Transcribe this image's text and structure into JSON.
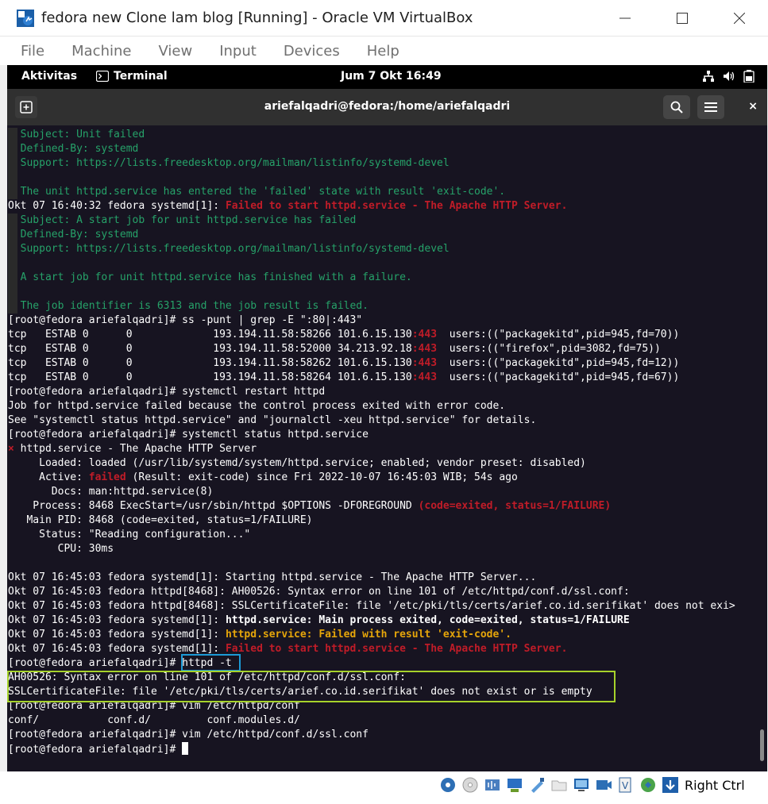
{
  "window": {
    "title": "fedora new Clone lam blog [Running] - Oracle VM VirtualBox",
    "controls": [
      "minimize-icon",
      "maximize-icon",
      "close-icon"
    ]
  },
  "menubar": {
    "items": [
      "File",
      "Machine",
      "View",
      "Input",
      "Devices",
      "Help"
    ]
  },
  "gnome": {
    "activities": "Aktivitas",
    "app_name": "Terminal",
    "clock": "Jum 7 Okt  16:49",
    "tray_icons": [
      "network-icon",
      "volume-icon",
      "battery-icon"
    ]
  },
  "terminal": {
    "title": "ariefalqadri@fedora:/home/ariefalqadri",
    "close_label": "×",
    "lines": [
      {
        "ind": true,
        "segs": [
          {
            "t": "  Subject: Unit failed",
            "c": "g"
          }
        ]
      },
      {
        "ind": true,
        "segs": [
          {
            "t": "  Defined-By: systemd",
            "c": "g"
          }
        ]
      },
      {
        "ind": true,
        "segs": [
          {
            "t": "  Support: https://lists.freedesktop.org/mailman/listinfo/systemd-devel",
            "c": "g"
          }
        ]
      },
      {
        "ind": true,
        "segs": [
          {
            "t": "",
            "c": ""
          }
        ]
      },
      {
        "ind": true,
        "segs": [
          {
            "t": "  The unit httpd.service has entered the 'failed' state with result 'exit-code'.",
            "c": "g"
          }
        ]
      },
      {
        "ind": false,
        "segs": [
          {
            "t": "Okt 07 16:40:32 fedora systemd[1]: ",
            "c": ""
          },
          {
            "t": "Failed to start httpd.service - The Apache HTTP Server.",
            "c": "r"
          }
        ]
      },
      {
        "ind": true,
        "segs": [
          {
            "t": "  Subject: A start job for unit httpd.service has failed",
            "c": "g"
          }
        ]
      },
      {
        "ind": true,
        "segs": [
          {
            "t": "  Defined-By: systemd",
            "c": "g"
          }
        ]
      },
      {
        "ind": true,
        "segs": [
          {
            "t": "  Support: https://lists.freedesktop.org/mailman/listinfo/systemd-devel",
            "c": "g"
          }
        ]
      },
      {
        "ind": true,
        "segs": [
          {
            "t": "",
            "c": ""
          }
        ]
      },
      {
        "ind": true,
        "segs": [
          {
            "t": "  A start job for unit httpd.service has finished with a failure.",
            "c": "g"
          }
        ]
      },
      {
        "ind": true,
        "segs": [
          {
            "t": "",
            "c": ""
          }
        ]
      },
      {
        "ind": true,
        "segs": [
          {
            "t": "  The job identifier is 6313 and the job result is failed.",
            "c": "g"
          }
        ]
      },
      {
        "ind": false,
        "segs": [
          {
            "t": "[root@fedora ariefalqadri]# ss -punt | grep -E \":80|:443\"",
            "c": ""
          }
        ]
      },
      {
        "ind": false,
        "segs": [
          {
            "t": "tcp   ESTAB 0      0             193.194.11.58:58266 101.6.15.130",
            "c": ""
          },
          {
            "t": ":443",
            "c": "r"
          },
          {
            "t": "  users:((\"packagekitd\",pid=945,fd=70))",
            "c": ""
          }
        ]
      },
      {
        "ind": false,
        "segs": [
          {
            "t": "tcp   ESTAB 0      0             193.194.11.58:52000 34.213.92.18",
            "c": ""
          },
          {
            "t": ":443",
            "c": "r"
          },
          {
            "t": "  users:((\"firefox\",pid=3082,fd=75))",
            "c": ""
          }
        ]
      },
      {
        "ind": false,
        "segs": [
          {
            "t": "tcp   ESTAB 0      0             193.194.11.58:58262 101.6.15.130",
            "c": ""
          },
          {
            "t": ":443",
            "c": "r"
          },
          {
            "t": "  users:((\"packagekitd\",pid=945,fd=12))",
            "c": ""
          }
        ]
      },
      {
        "ind": false,
        "segs": [
          {
            "t": "tcp   ESTAB 0      0             193.194.11.58:58264 101.6.15.130",
            "c": ""
          },
          {
            "t": ":443",
            "c": "r"
          },
          {
            "t": "  users:((\"packagekitd\",pid=945,fd=67))",
            "c": ""
          }
        ]
      },
      {
        "ind": false,
        "segs": [
          {
            "t": "[root@fedora ariefalqadri]# systemctl restart httpd",
            "c": ""
          }
        ]
      },
      {
        "ind": false,
        "segs": [
          {
            "t": "Job for httpd.service failed because the control process exited with error code.",
            "c": ""
          }
        ]
      },
      {
        "ind": false,
        "segs": [
          {
            "t": "See \"systemctl status httpd.service\" and \"journalctl -xeu httpd.service\" for details.",
            "c": ""
          }
        ]
      },
      {
        "ind": false,
        "segs": [
          {
            "t": "[root@fedora ariefalqadri]# systemctl status httpd.service",
            "c": ""
          }
        ]
      },
      {
        "ind": false,
        "segs": [
          {
            "t": "×",
            "c": "r"
          },
          {
            "t": " httpd.service - The Apache HTTP Server",
            "c": ""
          }
        ]
      },
      {
        "ind": false,
        "segs": [
          {
            "t": "     Loaded: loaded (/usr/lib/systemd/system/httpd.service; enabled; vendor preset: disabled)",
            "c": ""
          }
        ]
      },
      {
        "ind": false,
        "segs": [
          {
            "t": "     Active: ",
            "c": ""
          },
          {
            "t": "failed",
            "c": "r"
          },
          {
            "t": " (Result: exit-code) since Fri 2022-10-07 16:45:03 WIB; 54s ago",
            "c": ""
          }
        ]
      },
      {
        "ind": false,
        "segs": [
          {
            "t": "       Docs: man:httpd.service(8)",
            "c": ""
          }
        ]
      },
      {
        "ind": false,
        "segs": [
          {
            "t": "    Process: 8468 ExecStart=/usr/sbin/httpd $OPTIONS -DFOREGROUND ",
            "c": ""
          },
          {
            "t": "(code=exited, status=1/FAILURE)",
            "c": "r"
          }
        ]
      },
      {
        "ind": false,
        "segs": [
          {
            "t": "   Main PID: 8468 (code=exited, status=1/FAILURE)",
            "c": ""
          }
        ]
      },
      {
        "ind": false,
        "segs": [
          {
            "t": "     Status: \"Reading configuration...\"",
            "c": ""
          }
        ]
      },
      {
        "ind": false,
        "segs": [
          {
            "t": "        CPU: 30ms",
            "c": ""
          }
        ]
      },
      {
        "ind": false,
        "segs": [
          {
            "t": "",
            "c": ""
          }
        ]
      },
      {
        "ind": false,
        "segs": [
          {
            "t": "Okt 07 16:45:03 fedora systemd[1]: Starting httpd.service - The Apache HTTP Server...",
            "c": ""
          }
        ]
      },
      {
        "ind": false,
        "segs": [
          {
            "t": "Okt 07 16:45:03 fedora httpd[8468]: AH00526: Syntax error on line 101 of /etc/httpd/conf.d/ssl.conf:",
            "c": ""
          }
        ]
      },
      {
        "ind": false,
        "segs": [
          {
            "t": "Okt 07 16:45:03 fedora httpd[8468]: SSLCertificateFile: file '/etc/pki/tls/certs/arief.co.id.serifikat' does not exi>",
            "c": ""
          }
        ]
      },
      {
        "ind": false,
        "segs": [
          {
            "t": "Okt 07 16:45:03 fedora systemd[1]: ",
            "c": ""
          },
          {
            "t": "httpd.service: Main process exited, code=exited, status=1/FAILURE",
            "c": "b"
          }
        ]
      },
      {
        "ind": false,
        "segs": [
          {
            "t": "Okt 07 16:45:03 fedora systemd[1]: ",
            "c": ""
          },
          {
            "t": "httpd.service: Failed with result 'exit-code'.",
            "c": "y"
          }
        ]
      },
      {
        "ind": false,
        "segs": [
          {
            "t": "Okt 07 16:45:03 fedora systemd[1]: ",
            "c": ""
          },
          {
            "t": "Failed to start httpd.service - The Apache HTTP Server.",
            "c": "r"
          }
        ]
      },
      {
        "ind": false,
        "segs": [
          {
            "t": "[root@fedora ariefalqadri]# httpd -t",
            "c": ""
          }
        ]
      },
      {
        "ind": false,
        "segs": [
          {
            "t": "AH00526: Syntax error on line 101 of /etc/httpd/conf.d/ssl.conf:",
            "c": ""
          }
        ]
      },
      {
        "ind": false,
        "segs": [
          {
            "t": "SSLCertificateFile: file '/etc/pki/tls/certs/arief.co.id.serifikat' does not exist or is empty",
            "c": ""
          }
        ]
      },
      {
        "ind": false,
        "segs": [
          {
            "t": "[root@fedora ariefalqadri]# vim /etc/httpd/conf",
            "c": ""
          }
        ]
      },
      {
        "ind": false,
        "segs": [
          {
            "t": "conf/           conf.d/         conf.modules.d/",
            "c": ""
          }
        ]
      },
      {
        "ind": false,
        "segs": [
          {
            "t": "[root@fedora ariefalqadri]# vim /etc/httpd/conf.d/ssl.conf",
            "c": ""
          }
        ]
      },
      {
        "ind": false,
        "cursor": true,
        "segs": [
          {
            "t": "[root@fedora ariefalqadri]# ",
            "c": ""
          }
        ]
      }
    ]
  },
  "statusbar": {
    "icons": [
      "hard-disk-icon",
      "optical-drive-icon",
      "audio-icon",
      "network-adapter-icon",
      "usb-icon",
      "shared-folder-icon",
      "display-icon",
      "video-capture-icon",
      "virtualization-icon",
      "mouse-integration-icon",
      "keyboard-capture-icon"
    ],
    "host_key": "Right Ctrl"
  }
}
